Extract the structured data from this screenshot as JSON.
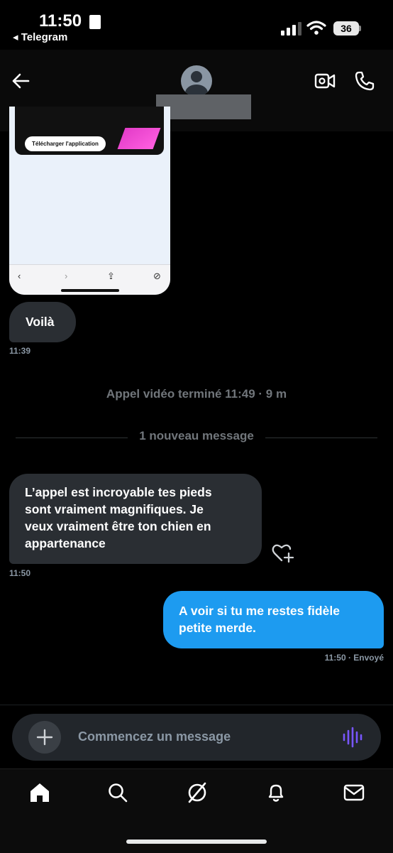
{
  "status_bar": {
    "time": "11:50",
    "back_app": "◂ Telegram",
    "battery": "36"
  },
  "header": {
    "back_icon": "arrow-left-icon",
    "video_icon": "video-camera-icon",
    "call_icon": "phone-icon"
  },
  "shared_image": {
    "download_button": "Télécharger l'application",
    "nav_back": "‹",
    "nav_forward": "›",
    "nav_share": "⇪",
    "nav_compass": "⊘"
  },
  "messages": {
    "m1_text": "Voilà",
    "m1_time": "11:39",
    "call_ended": "Appel vidéo terminé 11:49 · 9 m",
    "new_divider": "1 nouveau message",
    "m2_lines": [
      "L’appel est incroyable tes pieds",
      "sont vraiment magnifiques. Je",
      "veux vraiment être ton chien en",
      "appartenance"
    ],
    "m2_time": "11:50",
    "m3_lines": [
      "A voir si tu me restes fidèle",
      "petite merde."
    ],
    "m3_meta": "11:50 · Envoyé"
  },
  "composer": {
    "placeholder": "Commencez un message",
    "add_icon": "plus-icon",
    "voice_icon": "voice-wave-icon",
    "accent": "#7856ff"
  },
  "tabs": [
    "home-icon",
    "search-icon",
    "grok-icon",
    "bell-icon",
    "mail-icon"
  ],
  "colors": {
    "outgoing_bubble": "#1d9bf0",
    "incoming_bubble": "#2a2e33"
  }
}
